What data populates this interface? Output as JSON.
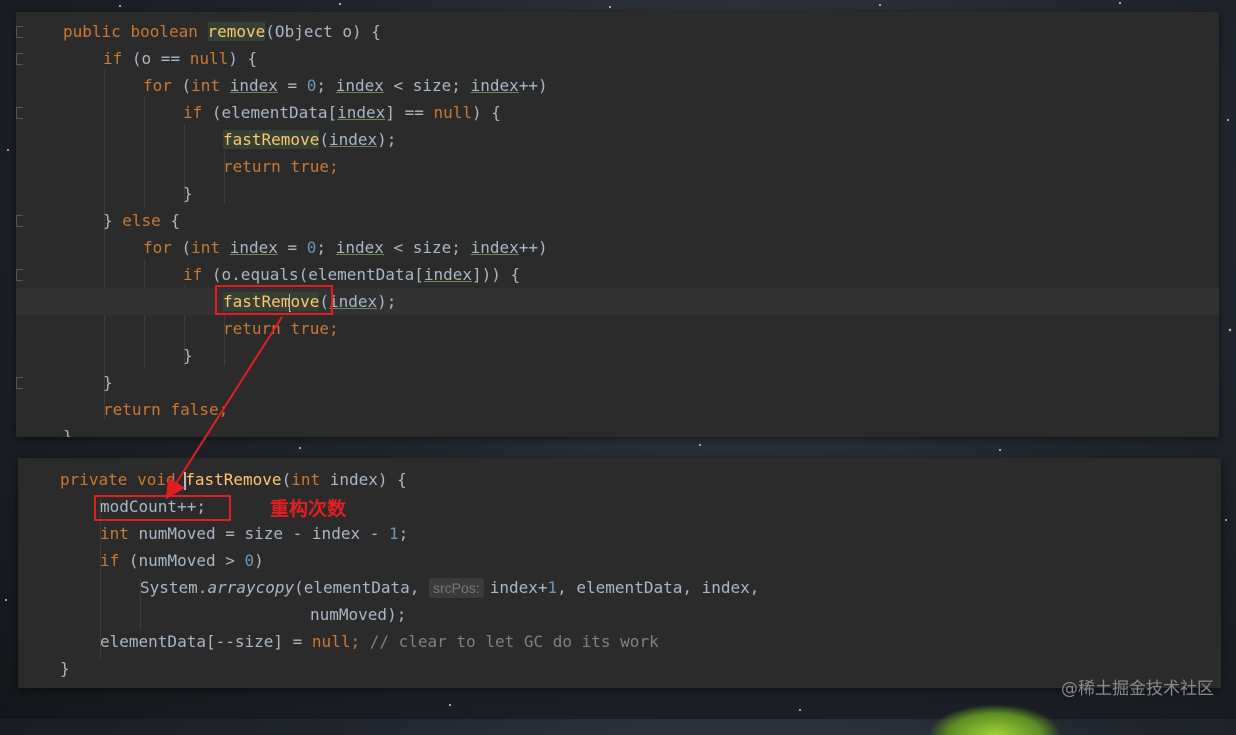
{
  "panel1": {
    "lines": [
      [
        "public ",
        "boolean ",
        "remove",
        "(Object o) {"
      ],
      [
        "if ",
        "(o == ",
        "null",
        ") {"
      ],
      [
        "for ",
        "(",
        "int ",
        "index",
        " = ",
        "0",
        "; ",
        "index",
        " < size; ",
        "index",
        "++)"
      ],
      [
        "if ",
        "(elementData[",
        "index",
        "] == ",
        "null",
        ") {"
      ],
      [
        "fastRemove",
        "(",
        "index",
        ");"
      ],
      [
        "return ",
        "true",
        ";"
      ],
      [
        "}"
      ],
      [
        "} ",
        "else ",
        "{"
      ],
      [
        "for ",
        "(",
        "int ",
        "index",
        " = ",
        "0",
        "; ",
        "index",
        " < size; ",
        "index",
        "++)"
      ],
      [
        "if ",
        "(o.equals(elementData[",
        "index",
        "])) {"
      ],
      [
        "fastRem",
        "ove",
        "(",
        "index",
        ");"
      ],
      [
        "return ",
        "true",
        ";"
      ],
      [
        "}"
      ],
      [
        "}"
      ],
      [
        "return ",
        "false",
        ";"
      ],
      [
        "}"
      ]
    ]
  },
  "panel2": {
    "lines": [
      [
        "private ",
        "void ",
        "fastRemove",
        "(",
        "int ",
        "index) {"
      ],
      [
        "modCount++;"
      ],
      [
        "int ",
        "numMoved = size - index - ",
        "1",
        ";"
      ],
      [
        "if ",
        "(numMoved > ",
        "0",
        ")"
      ],
      [
        "System.",
        "arraycopy",
        "(elementData, ",
        "srcPos:",
        "index+",
        "1",
        ", elementData, index,"
      ],
      [
        "numMoved);"
      ],
      [
        "elementData[--size] = ",
        "null",
        "; ",
        "// clear to let GC do its work"
      ],
      [
        "}"
      ]
    ]
  },
  "annotation": {
    "label": "重构次数",
    "color": "#e02020"
  },
  "watermark": "@稀土掘金技术社区",
  "colors": {
    "keyword": "#cc7832",
    "method": "#ffc66d",
    "number": "#6897bb",
    "comment": "#808080",
    "text": "#a9b7c6",
    "background": "#2b2b2b"
  }
}
